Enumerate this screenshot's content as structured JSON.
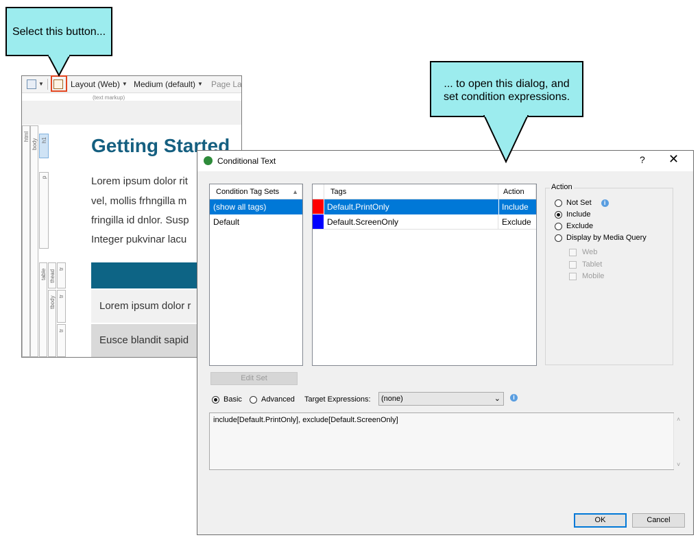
{
  "callouts": {
    "first": "Select this button...",
    "second": "... to open this dialog, and set condition expressions."
  },
  "editor": {
    "toolbar": {
      "layout": "Layout (Web)",
      "medium": "Medium (default)",
      "page_layout": "Page Layout"
    },
    "text_markup_label": "(text markup)",
    "structure_labels": [
      "html",
      "body",
      "h1",
      "p",
      "table",
      "thead",
      "tr",
      "tbody",
      "tr",
      "tr"
    ],
    "heading": "Getting Started",
    "body_lines": [
      "Lorem ipsum dolor rit",
      "vel, mollis frhngilla m",
      "fringilla id dnlor. Susp",
      "Integer pukvinar lacu"
    ],
    "table_rows": [
      "Lorem ipsum dolor r",
      "Eusce blandit sapid"
    ]
  },
  "dialog": {
    "title": "Conditional Text",
    "help": "?",
    "close": "✕",
    "tag_sets": {
      "header": "Condition Tag Sets",
      "items": [
        "(show all tags)",
        "Default"
      ]
    },
    "tags": {
      "header_tags": "Tags",
      "header_action": "Action",
      "rows": [
        {
          "name": "Default.PrintOnly",
          "action": "Include",
          "color": "#ff0000"
        },
        {
          "name": "Default.ScreenOnly",
          "action": "Exclude",
          "color": "#0000ff"
        }
      ]
    },
    "action": {
      "legend": "Action",
      "options": [
        "Not Set",
        "Include",
        "Exclude",
        "Display by Media Query"
      ],
      "selected": "Include",
      "media": [
        "Web",
        "Tablet",
        "Mobile"
      ]
    },
    "edit_set": "Edit Set",
    "mode": {
      "basic": "Basic",
      "advanced": "Advanced",
      "selected": "Basic"
    },
    "target_label": "Target Expressions:",
    "target_value": "(none)",
    "expression": "include[Default.PrintOnly], exclude[Default.ScreenOnly]",
    "ok": "OK",
    "cancel": "Cancel"
  },
  "colors": {
    "callout": "#9cecee",
    "heading": "#155f80",
    "selection": "#0078d7",
    "highlight": "#e2451f"
  }
}
